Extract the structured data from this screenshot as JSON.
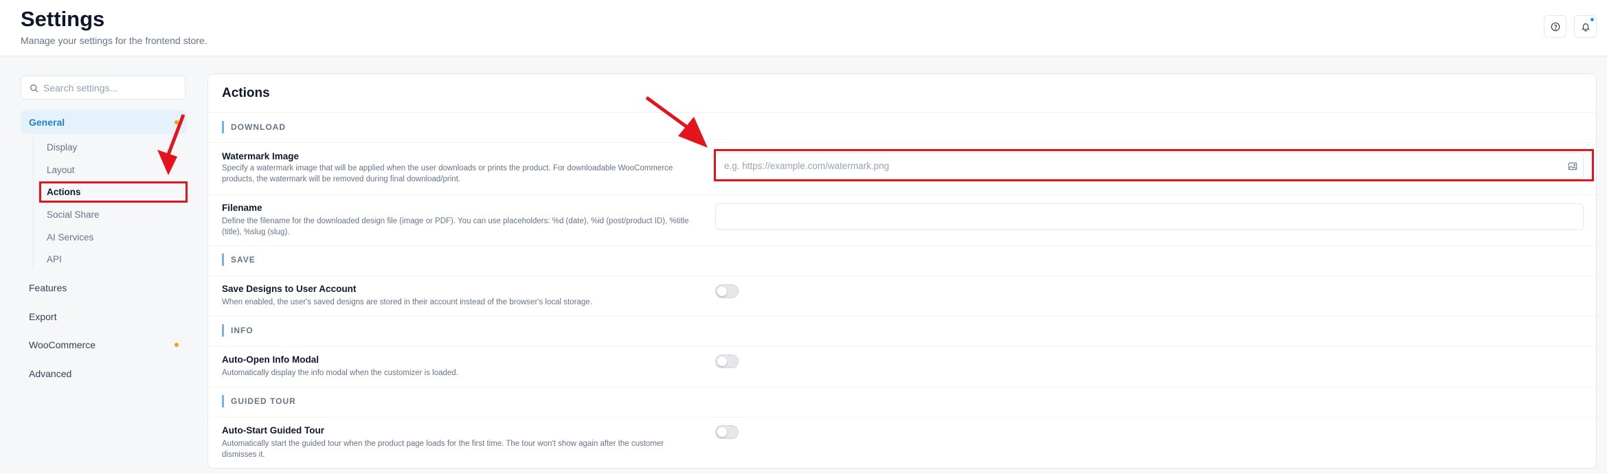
{
  "header": {
    "title": "Settings",
    "subtitle": "Manage your settings for the frontend store."
  },
  "sidebar": {
    "search_placeholder": "Search settings...",
    "items": [
      {
        "label": "General"
      },
      {
        "label": "Features"
      },
      {
        "label": "Export"
      },
      {
        "label": "WooCommerce"
      },
      {
        "label": "Advanced"
      }
    ],
    "general_subitems": [
      {
        "label": "Display"
      },
      {
        "label": "Layout"
      },
      {
        "label": "Actions"
      },
      {
        "label": "Social Share"
      },
      {
        "label": "AI Services"
      },
      {
        "label": "API"
      }
    ]
  },
  "panel": {
    "title": "Actions",
    "sections": {
      "download": "DOWNLOAD",
      "save": "SAVE",
      "info": "INFO",
      "guided_tour": "GUIDED TOUR"
    },
    "watermark": {
      "label": "Watermark Image",
      "description": "Specify a watermark image that will be applied when the user downloads or prints the product. For downloadable WooCommerce products, the watermark will be removed during final download/print.",
      "placeholder": "e.g. https://example.com/watermark.png",
      "value": ""
    },
    "filename": {
      "label": "Filename",
      "description": "Define the filename for the downloaded design file (image or PDF). You can use placeholders: %d (date), %id (post/product ID), %title (title), %slug (slug).",
      "value": ""
    },
    "save_designs": {
      "label": "Save Designs to User Account",
      "description": "When enabled, the user's saved designs are stored in their account instead of the browser's local storage.",
      "enabled": false
    },
    "auto_open_info": {
      "label": "Auto-Open Info Modal",
      "description": "Automatically display the info modal when the customizer is loaded.",
      "enabled": false
    },
    "auto_start_tour": {
      "label": "Auto-Start Guided Tour",
      "description": "Automatically start the guided tour when the product page loads for the first time. The tour won't show again after the customer dismisses it.",
      "enabled": false
    }
  },
  "colors": {
    "accent": "#1f84c8",
    "active_bg": "#e6f2fb",
    "status_dot": "#f59e0b",
    "annotation_red": "#e3141b",
    "section_bar": "#7bb3e0"
  },
  "icons": {
    "help": "question-circle-icon",
    "notifications": "bell-icon",
    "search": "search-icon",
    "image": "image-icon"
  }
}
